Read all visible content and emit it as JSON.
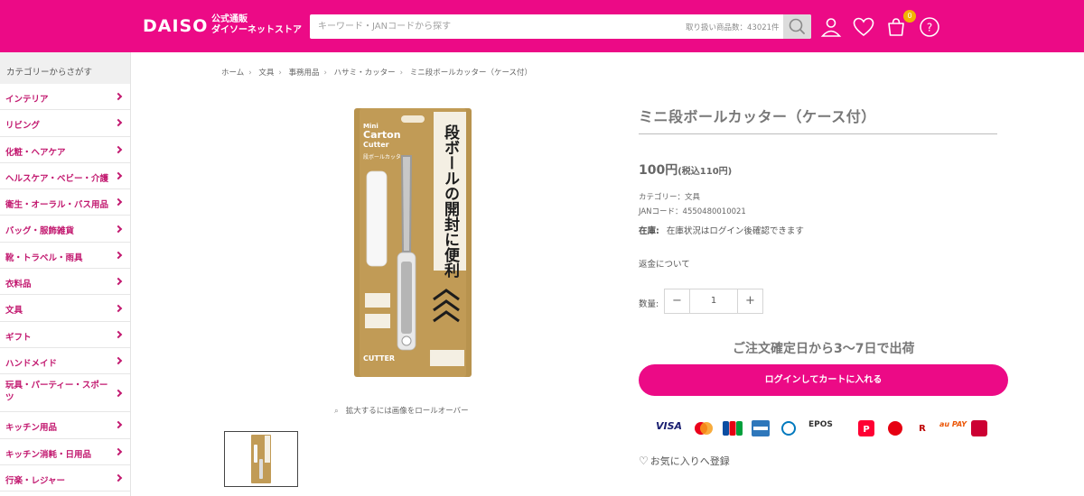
{
  "header": {
    "logo": "DAISO",
    "logo_sub_1": "公式通販",
    "logo_sub_2": "ダイソーネットストア",
    "search_placeholder": "キーワード・JANコードから探す",
    "item_count": "取り扱い商品数：43021件",
    "cart_count": "0",
    "icons": [
      "search-icon",
      "user-icon",
      "heart-icon",
      "cart-icon",
      "help-icon"
    ]
  },
  "sidebar": {
    "heading": "カテゴリーからさがす",
    "items": [
      {
        "label": "インテリア"
      },
      {
        "label": "リビング"
      },
      {
        "label": "化粧・ヘアケア"
      },
      {
        "label": "ヘルスケア・ベビー・介護"
      },
      {
        "label": "衛生・オーラル・バス用品"
      },
      {
        "label": "バッグ・服飾雑貨"
      },
      {
        "label": "靴・トラベル・雨具"
      },
      {
        "label": "衣料品"
      },
      {
        "label": "文具"
      },
      {
        "label": "ギフト"
      },
      {
        "label": "ハンドメイド"
      },
      {
        "label": "玩具・パーティー・スポーツ"
      },
      {
        "label": "キッチン用品"
      },
      {
        "label": "キッチン消耗・日用品"
      },
      {
        "label": "行楽・レジャー"
      }
    ]
  },
  "breadcrumb": [
    "ホーム",
    "文具",
    "事務用品",
    "ハサミ・カッター",
    "ミニ段ボールカッター（ケース付）"
  ],
  "product": {
    "title": "ミニ段ボールカッター（ケース付）",
    "price": "100円",
    "price_tax": "(税込110円)",
    "category": "カテゴリー：文具",
    "jan": "JANコード：4550480010021",
    "stock_label": "在庫:",
    "stock_text": "在庫状況はログイン後確認できます",
    "refund": "返金について",
    "qty_label": "数量:",
    "qty_value": "1",
    "qty_minus": "−",
    "qty_plus": "+",
    "shipping": "ご注文確定日から3〜7日で出荷",
    "cart_button": "ログインしてカートに入れる",
    "favorite": "お気に入りへ登録",
    "zoom_hint": "拡大するには画像をロールオーバー",
    "package_text": {
      "mini": "Mini",
      "carton": "Carton",
      "cutter": "Cutter",
      "jp_name": "段ボールカッター",
      "vertical": "段ボールの開封に便利",
      "bottom": "CUTTER"
    }
  },
  "payments": [
    "VISA",
    "Mastercard",
    "JCB",
    "AMERICAN EXPRESS",
    "Diners Club",
    "EPOS",
    "PayPay",
    "d払い",
    "楽天Pay",
    "au PAY",
    "d払い"
  ],
  "colors": {
    "brand_pink": "#ec0a86",
    "category_text": "#c2186f"
  }
}
